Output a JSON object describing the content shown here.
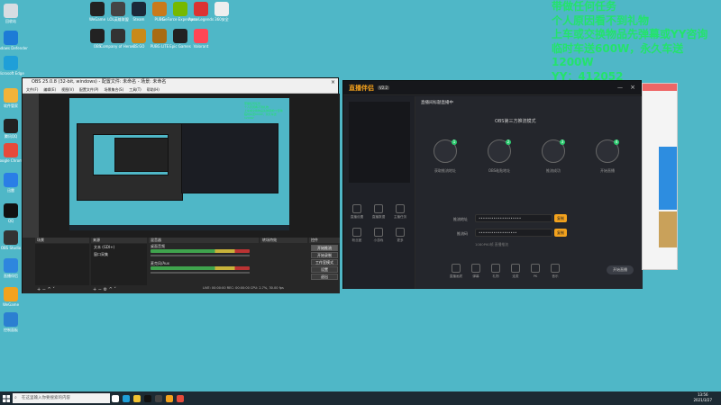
{
  "desktop": {
    "icons": [
      {
        "label": "回收站",
        "color": "#d7dde2"
      },
      {
        "label": "Windows Defender",
        "color": "#1d7bd6"
      },
      {
        "label": "Microsoft Edge",
        "color": "#1f9fd8"
      },
      {
        "label": "软件管家",
        "color": "#f1b33a"
      },
      {
        "label": "腾讯QQ",
        "color": "#222"
      },
      {
        "label": "Google Chrome",
        "color": "#e64a3a"
      },
      {
        "label": "迅雷",
        "color": "#2a7ee6"
      },
      {
        "label": "QQ",
        "color": "#111"
      },
      {
        "label": "OBS Studio",
        "color": "#333"
      },
      {
        "label": "直播伴侣",
        "color": "#2e86de"
      },
      {
        "label": "WeGame",
        "color": "#f3a21d"
      },
      {
        "label": "控制面板",
        "color": "#2b7fd1"
      }
    ],
    "top_icons": [
      {
        "label": "WeGame",
        "color": "#222"
      },
      {
        "label": "LOL英雄联盟",
        "color": "#444"
      },
      {
        "label": "Steam",
        "color": "#1b2838"
      },
      {
        "label": "PUBG",
        "color": "#c97a1c"
      },
      {
        "label": "GeForce Experience",
        "color": "#76b900"
      },
      {
        "label": "Apex Legends",
        "color": "#d33"
      },
      {
        "label": "360安全",
        "color": "#eee"
      },
      {
        "label": "OBS",
        "color": "#222"
      },
      {
        "label": "Company of Heroes",
        "color": "#333"
      },
      {
        "label": "CS:GO",
        "color": "#c98a1a"
      },
      {
        "label": "PUBG LITE",
        "color": "#a86b12"
      },
      {
        "label": "Epic Games",
        "color": "#222"
      },
      {
        "label": "Valorant",
        "color": "#ff4655"
      }
    ]
  },
  "overlay": {
    "line1": "带做任何任务",
    "line2": "个人原因看不到礼物",
    "line3": "上车或交换物品先弹幕或YY咨询",
    "line4": "临时车送600W，永久车送1200W",
    "line5": "YY：412052",
    "color": "#23e36b"
  },
  "obs": {
    "title": "OBS 25.0.8 (32-bit, windows) - 配置文件: 未命名 - 场景: 未命名",
    "menu": [
      "文件(F)",
      "编辑(E)",
      "视图(V)",
      "配置文件(P)",
      "场景集合(S)",
      "工具(T)",
      "帮助(H)"
    ],
    "docks": {
      "scenes": "场景",
      "sources": "来源",
      "mixer": "混音器",
      "transitions": "转场特效",
      "controls": "控件"
    },
    "sources": [
      "文本 (GDI+)",
      "窗口采集"
    ],
    "mixer_channels": [
      "桌面音频",
      "麦克风/Aux"
    ],
    "controls": [
      "开始推流",
      "开始录制",
      "工作室模式",
      "设置",
      "退出"
    ],
    "status": "LIVE: 00:00:00  REC: 00:00:00  CPU: 2.7%, 30.00 fps"
  },
  "live_app": {
    "logo": "直播伴侣",
    "version": "V2.2",
    "room": "直播间标题直播中",
    "mode_title": "OBS第三方推流模式",
    "steps": [
      "获取推流地址",
      "OBS粘贴地址",
      "推流成功",
      "开始直播"
    ],
    "rtmp_label": "推流地址",
    "key_label": "推流码",
    "rtmp_value": "••••••••••••••••••••",
    "key_value": "••••••••••••••••••",
    "copy": "复制",
    "start_button": "开始直播",
    "hint": "1080P60帧 直播推流",
    "left_tools": [
      "直播设置",
      "直播数据",
      "主播任务",
      "粉丝团",
      "小游戏",
      "更多"
    ],
    "bottom_tools": [
      "直播画质",
      "弹幕",
      "礼物",
      "连麦",
      "PK",
      "音乐"
    ]
  },
  "taskbar": {
    "search_placeholder": "在这里输入你要搜索的内容",
    "time": "13:56",
    "date": "2021/3/27",
    "icons": [
      {
        "name": "task-view",
        "color": "#fff"
      },
      {
        "name": "edge",
        "color": "#1f9fd8"
      },
      {
        "name": "explorer",
        "color": "#f1c232"
      },
      {
        "name": "qq",
        "color": "#111"
      },
      {
        "name": "obs",
        "color": "#444"
      },
      {
        "name": "live",
        "color": "#f3a21d"
      },
      {
        "name": "chrome",
        "color": "#e64a3a"
      }
    ]
  }
}
